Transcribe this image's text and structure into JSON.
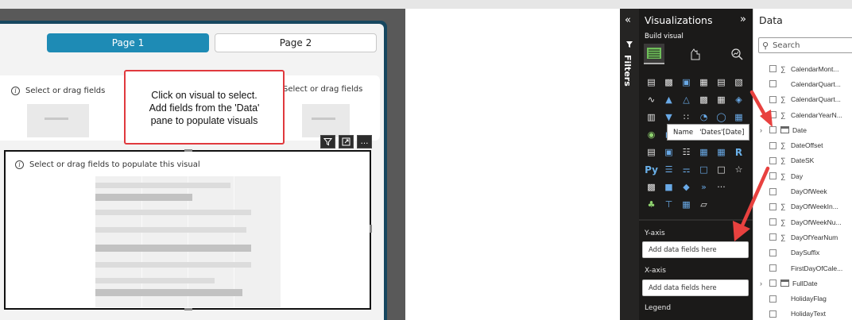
{
  "report": {
    "pages": [
      {
        "label": "Page 1",
        "active": true
      },
      {
        "label": "Page 2",
        "active": false
      }
    ],
    "card_hint_left": "Select or drag fields",
    "card_hint_right": "Select or drag fields",
    "callout_lines": [
      "Click on visual to select.",
      "Add fields from the 'Data'",
      "pane to populate visuals"
    ],
    "visual_hint": "Select or drag fields to populate this visual",
    "toolbar": {
      "filter_icon": "filter-icon",
      "focus_icon": "focus-mode-icon",
      "more_label": "…"
    }
  },
  "filters": {
    "label": "Filters",
    "collapse_glyph": "«"
  },
  "visualizations": {
    "title": "Visualizations",
    "collapse_glyph": "»",
    "build_label": "Build visual",
    "tooltip_name_label": "Name",
    "tooltip_value": "'Dates'[Date]",
    "more_label": "···",
    "py_label": "Py",
    "r_label": "R",
    "wells": [
      {
        "label": "Y-axis",
        "placeholder": "Add data fields here"
      },
      {
        "label": "X-axis",
        "placeholder": "Add data fields here"
      },
      {
        "label": "Legend",
        "placeholder": ""
      }
    ]
  },
  "data_pane": {
    "title": "Data",
    "search_placeholder": "Search",
    "fields": [
      {
        "name": "CalendarMont...",
        "sigma": true,
        "table": false,
        "expand": false
      },
      {
        "name": "CalendarQuart...",
        "sigma": false,
        "table": false,
        "expand": false
      },
      {
        "name": "CalendarQuart...",
        "sigma": true,
        "table": false,
        "expand": false
      },
      {
        "name": "CalendarYearN...",
        "sigma": true,
        "table": false,
        "expand": false
      },
      {
        "name": "Date",
        "sigma": false,
        "table": true,
        "expand": true
      },
      {
        "name": "DateOffset",
        "sigma": true,
        "table": false,
        "expand": false
      },
      {
        "name": "DateSK",
        "sigma": true,
        "table": false,
        "expand": false
      },
      {
        "name": "Day",
        "sigma": true,
        "table": false,
        "expand": false
      },
      {
        "name": "DayOfWeek",
        "sigma": false,
        "table": false,
        "expand": false
      },
      {
        "name": "DayOfWeekIn...",
        "sigma": true,
        "table": false,
        "expand": false
      },
      {
        "name": "DayOfWeekNu...",
        "sigma": true,
        "table": false,
        "expand": false
      },
      {
        "name": "DayOfYearNum",
        "sigma": true,
        "table": false,
        "expand": false
      },
      {
        "name": "DaySuffix",
        "sigma": false,
        "table": false,
        "expand": false
      },
      {
        "name": "FirstDayOfCale...",
        "sigma": false,
        "table": false,
        "expand": false
      },
      {
        "name": "FullDate",
        "sigma": false,
        "table": true,
        "expand": true
      },
      {
        "name": "HolidayFlag",
        "sigma": false,
        "table": false,
        "expand": false
      },
      {
        "name": "HolidayText",
        "sigma": false,
        "table": false,
        "expand": false
      }
    ]
  },
  "colors": {
    "accent": "#1e8bb5",
    "frame": "#17475f",
    "callout_border": "#e0393e",
    "arrow": "#e8413f",
    "pane_dark": "#1b1a19"
  }
}
